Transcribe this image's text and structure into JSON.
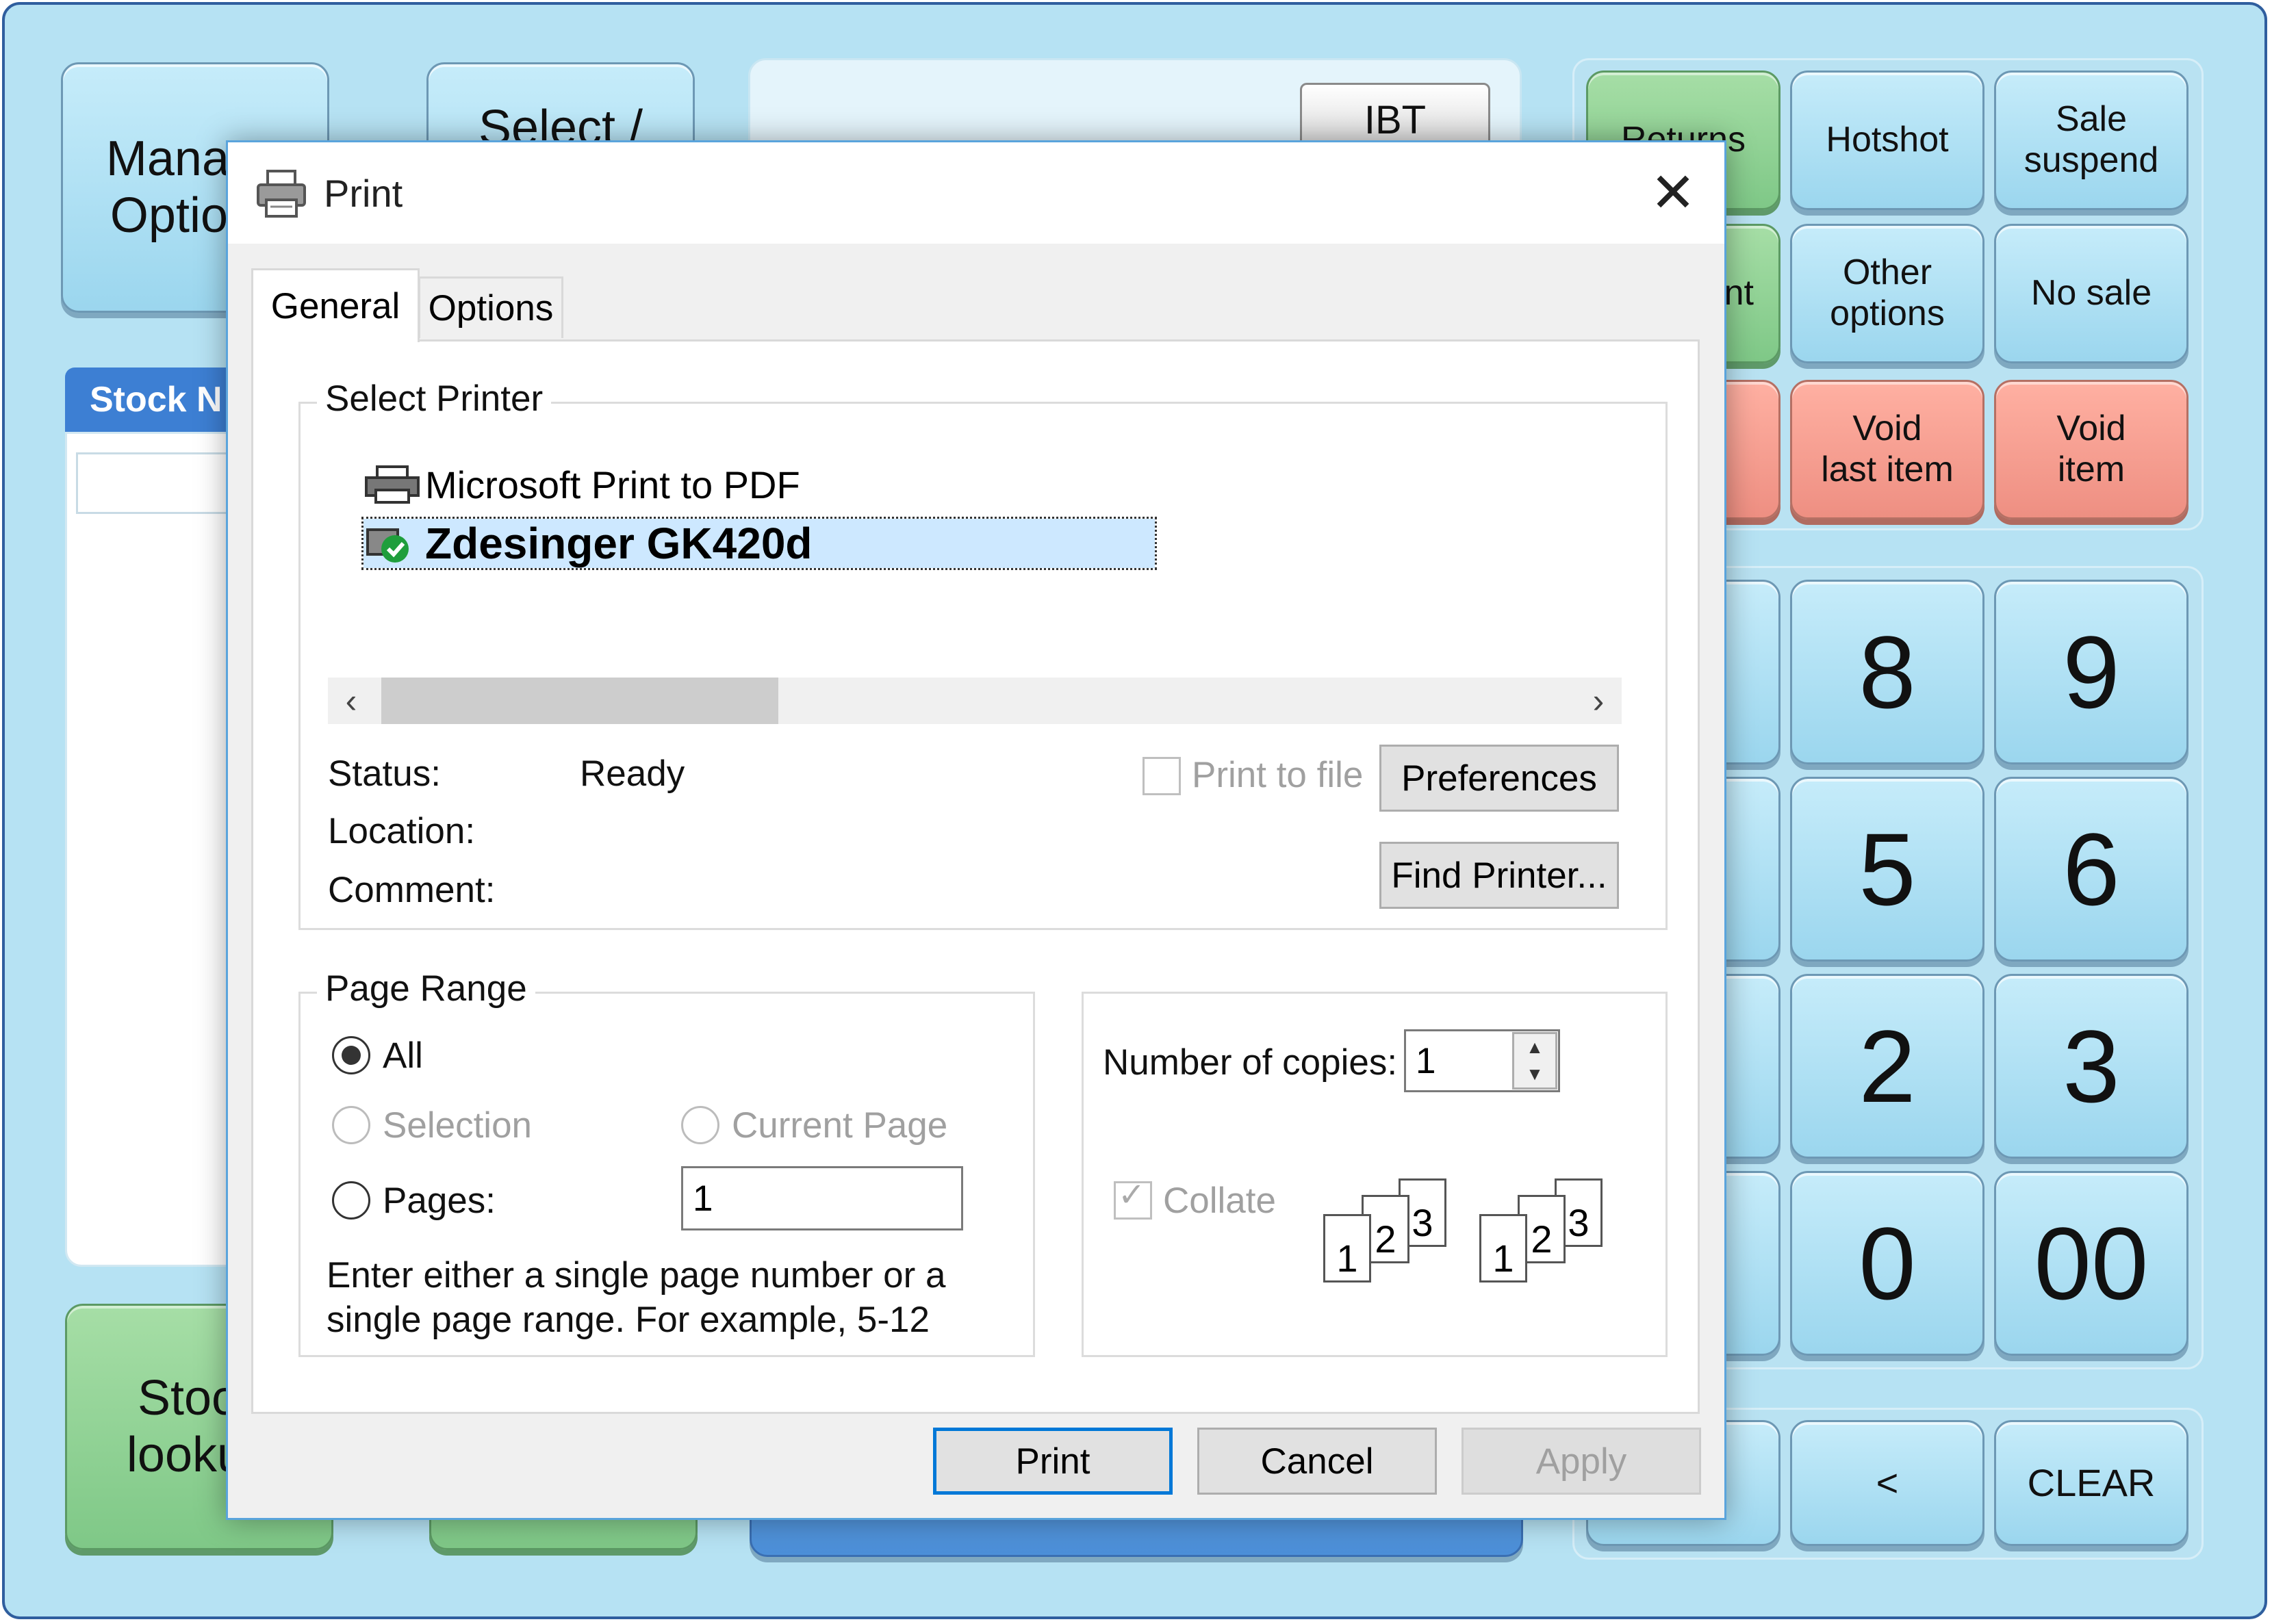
{
  "background_buttons": {
    "manage_options": "Manage\nOptions",
    "select": "Select /",
    "ibt": "IBT",
    "stock_header": "Stock N",
    "stock_lookup": "Stock\nlookup",
    "returns": "Returns",
    "hotshot": "Hotshot",
    "sale_suspend": "Sale\nsuspend",
    "partial_nt": "nt",
    "other_options": "Other\noptions",
    "no_sale": "No sale",
    "void_last_item": "Void\nlast item",
    "void_item": "Void\nitem",
    "keypad": [
      "8",
      "9",
      "5",
      "6",
      "2",
      "3",
      "0",
      "00"
    ],
    "back": "<",
    "clear": "CLEAR"
  },
  "dialog": {
    "title": "Print",
    "tabs": [
      {
        "label": "General"
      },
      {
        "label": "Options"
      }
    ],
    "select_printer": {
      "legend": "Select Printer",
      "printers": [
        {
          "name": "Microsoft Print to PDF",
          "icon": "printer-icon",
          "selected": false
        },
        {
          "name": "Zdesinger GK420d",
          "icon": "default-printer-check-icon",
          "selected": true
        }
      ],
      "status_label": "Status:",
      "status_value": "Ready",
      "location_label": "Location:",
      "comment_label": "Comment:",
      "print_to_file": "Print to file",
      "preferences": "Preferences",
      "find_printer": "Find Printer..."
    },
    "page_range": {
      "legend": "Page Range",
      "all": "All",
      "selection": "Selection",
      "current_page": "Current Page",
      "pages": "Pages:",
      "pages_value": "1",
      "hint": "Enter either a single page number or a single page range.  For example, 5-12"
    },
    "copies": {
      "label": "Number of copies:",
      "value": "1",
      "collate": "Collate",
      "collate_pages": [
        "1",
        "2",
        "3"
      ]
    },
    "buttons": {
      "print": "Print",
      "cancel": "Cancel",
      "apply": "Apply"
    }
  }
}
